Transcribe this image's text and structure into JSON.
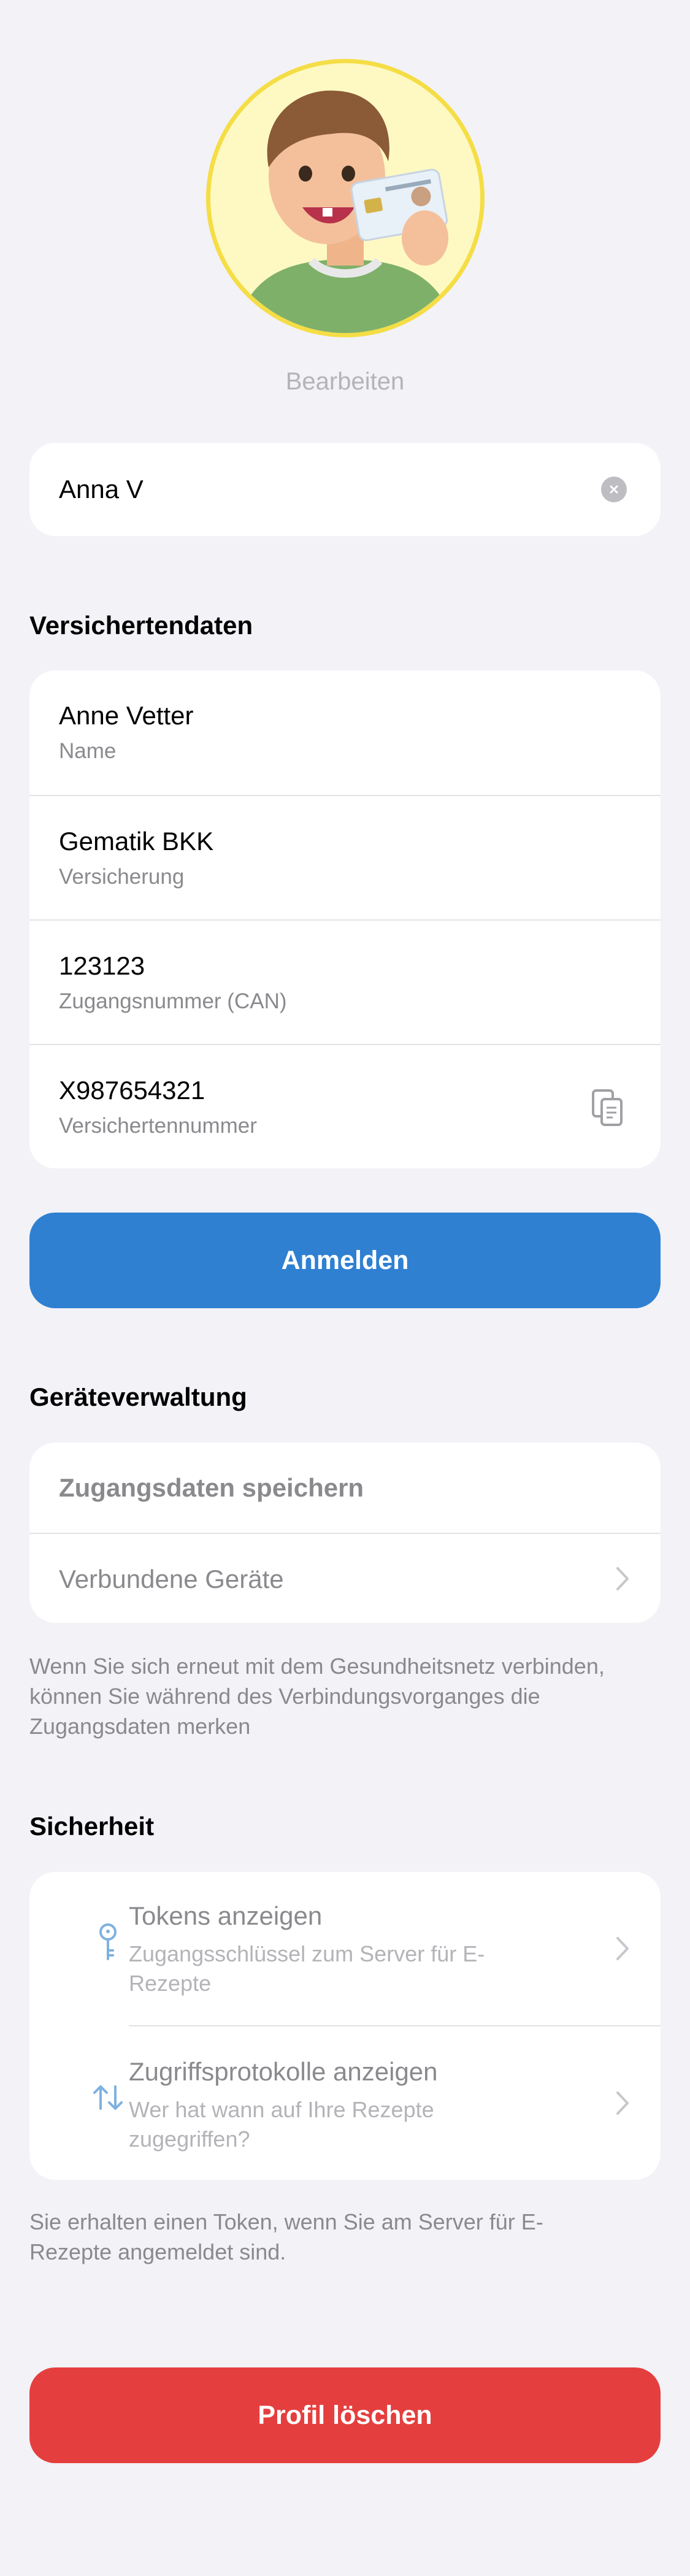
{
  "colors": {
    "background": "#f2f2f7",
    "primary": "#2f80d1",
    "danger": "#e53e3e",
    "avatar_bg": "#fef9c3",
    "avatar_border": "#f5dd45"
  },
  "profile": {
    "edit_label": "Bearbeiten",
    "name_value": "Anna V",
    "clear_icon": "clear-circle-icon"
  },
  "insurance": {
    "title": "Versichertendaten",
    "fields": [
      {
        "value": "Anne Vetter",
        "label": "Name"
      },
      {
        "value": "Gematik BKK",
        "label": "Versicherung"
      },
      {
        "value": "123123",
        "label": "Zugangsnummer (CAN)"
      },
      {
        "value": "X987654321",
        "label": "Versichertennummer",
        "icon": "copy-icon"
      }
    ],
    "login_button": "Anmelden"
  },
  "devices": {
    "title": "Geräteverwaltung",
    "items": [
      {
        "label": "Zugangsdaten speichern"
      },
      {
        "label": "Verbundene Geräte",
        "icon": "chevron-right-icon"
      }
    ],
    "footnote": "Wenn Sie sich erneut mit dem Gesundheitsnetz verbinden, können Sie während des Verbindungsvorganges die Zugangsdaten merken"
  },
  "security": {
    "title": "Sicherheit",
    "items": [
      {
        "title": "Tokens anzeigen",
        "subtitle": "Zugangsschlüssel zum Server für E-Rezepte",
        "icon": "key-icon"
      },
      {
        "title": "Zugriffsprotokolle anzeigen",
        "subtitle": "Wer hat wann auf Ihre Rezepte zugegriffen?",
        "icon": "arrows-up-down-icon"
      }
    ],
    "footnote": "Sie erhalten einen Token, wenn Sie am Server für E-Rezepte angemeldet sind."
  },
  "delete_button": "Profil löschen"
}
